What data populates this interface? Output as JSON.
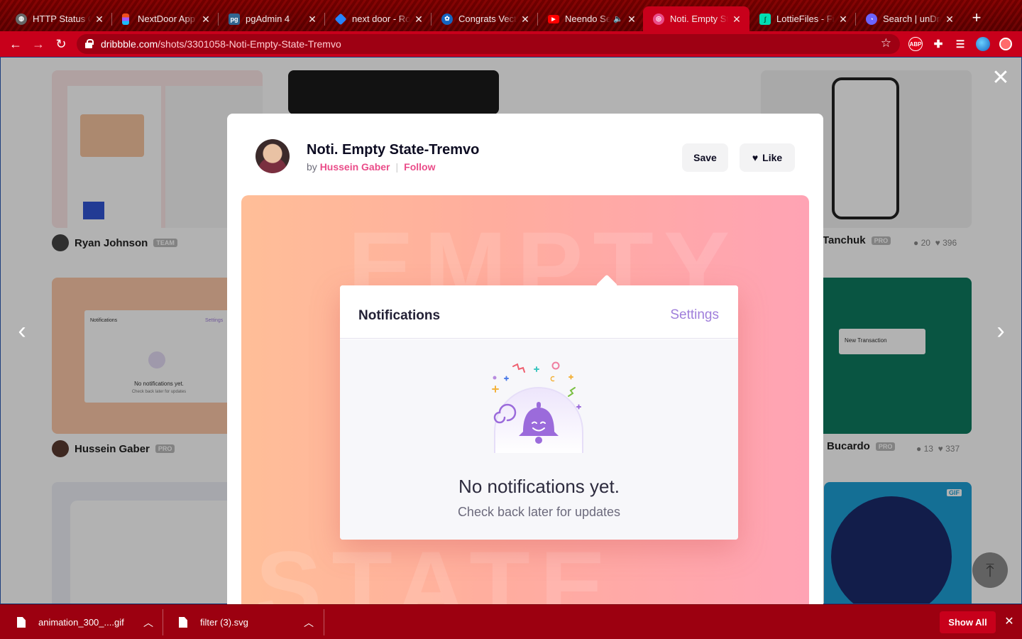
{
  "browser": {
    "tabs": [
      {
        "title": "HTTP Status C",
        "icon": "globe-icon",
        "color": "#555555"
      },
      {
        "title": "NextDoor App",
        "icon": "figma-icon",
        "color": "#f24e1e"
      },
      {
        "title": "pgAdmin 4",
        "icon": "pgadmin-icon",
        "color": "#326690"
      },
      {
        "title": "next door - Ro",
        "icon": "jira-icon",
        "color": "#2684ff"
      },
      {
        "title": "Congrats Vect",
        "icon": "vecteezy-icon",
        "color": "#1565c0"
      },
      {
        "title": "Neendo Se",
        "icon": "youtube-icon",
        "color": "#ff0000"
      },
      {
        "title": "Noti. Empty St",
        "icon": "dribbble-icon",
        "color": "#ea4c89"
      },
      {
        "title": "LottieFiles - Fr",
        "icon": "lottiefiles-icon",
        "color": "#00ddb3"
      },
      {
        "title": "Search | unDra",
        "icon": "undraw-icon",
        "color": "#6c63ff"
      }
    ],
    "active_tab_index": 6,
    "url_domain": "dribbble.com",
    "url_path": "/shots/3301058-Noti-Empty-State-Tremvo",
    "extension_abp": "ABP"
  },
  "background_shots": [
    {
      "author": "Ryan Johnson",
      "badge": "TEAM"
    },
    {
      "author": "Tanchuk",
      "badge": "PRO",
      "comments": "20",
      "likes": "396"
    },
    {
      "author": "Hussein Gaber",
      "badge": "PRO"
    },
    {
      "author": "Bucardo",
      "badge": "PRO",
      "comments": "13",
      "likes": "337"
    }
  ],
  "background_thumb": {
    "notif_title": "Notifications",
    "notif_settings": "Settings",
    "empty_title": "No notifications yet.",
    "empty_sub": "Check back later for updates",
    "transaction": "New Transaction",
    "gif_badge": "GIF"
  },
  "shot": {
    "title": "Noti. Empty State-Tremvo",
    "by": "by",
    "author": "Hussein Gaber",
    "follow": "Follow",
    "save": "Save",
    "like": "Like"
  },
  "artwork": {
    "watermark_top": "EMPTY",
    "watermark_bottom": "STATE",
    "header_title": "Notifications",
    "header_link": "Settings",
    "empty_title": "No notifications yet.",
    "empty_subtitle": "Check back later for updates"
  },
  "downloads": [
    {
      "name": "animation_300_....gif"
    },
    {
      "name": "filter (3).svg"
    }
  ],
  "downloads_show_all": "Show All"
}
